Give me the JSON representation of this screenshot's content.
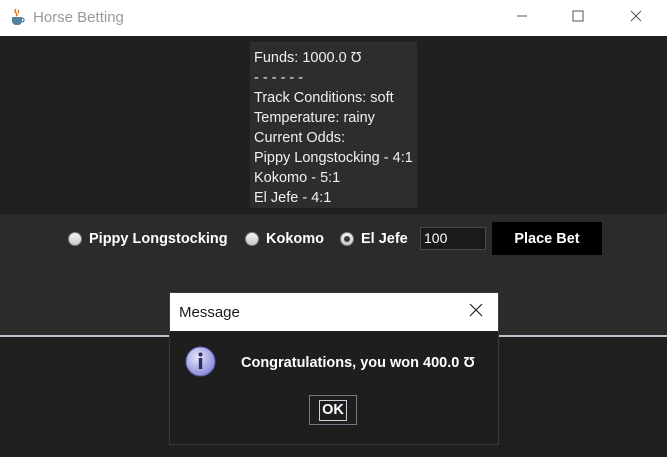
{
  "window": {
    "title": "Horse Betting"
  },
  "info": {
    "lines": [
      "Funds: 1000.0 Ʊ",
      "- - - - - -",
      "Track Conditions: soft",
      "Temperature: rainy",
      "Current Odds:",
      "Pippy Longstocking - 4:1",
      "Kokomo - 5:1",
      "El Jefe - 4:1"
    ]
  },
  "bet": {
    "horses": [
      {
        "label": "Pippy Longstocking",
        "selected": false
      },
      {
        "label": "Kokomo",
        "selected": false
      },
      {
        "label": "El Jefe",
        "selected": true
      }
    ],
    "amount": "100",
    "place_bet_label": "Place Bet"
  },
  "dialog": {
    "title": "Message",
    "message": "Congratulations, you won 400.0 Ʊ",
    "ok_label": "OK"
  },
  "icons": {
    "app": "java-cup-icon",
    "minimize": "minimize-icon",
    "maximize": "maximize-icon",
    "close": "close-icon",
    "info": "info-icon"
  },
  "colors": {
    "background_dark": "#202020",
    "panel": "#2b2b2b",
    "info_box": "#2d2d2d",
    "button": "#000000",
    "info_icon": "#8b8bd8"
  }
}
